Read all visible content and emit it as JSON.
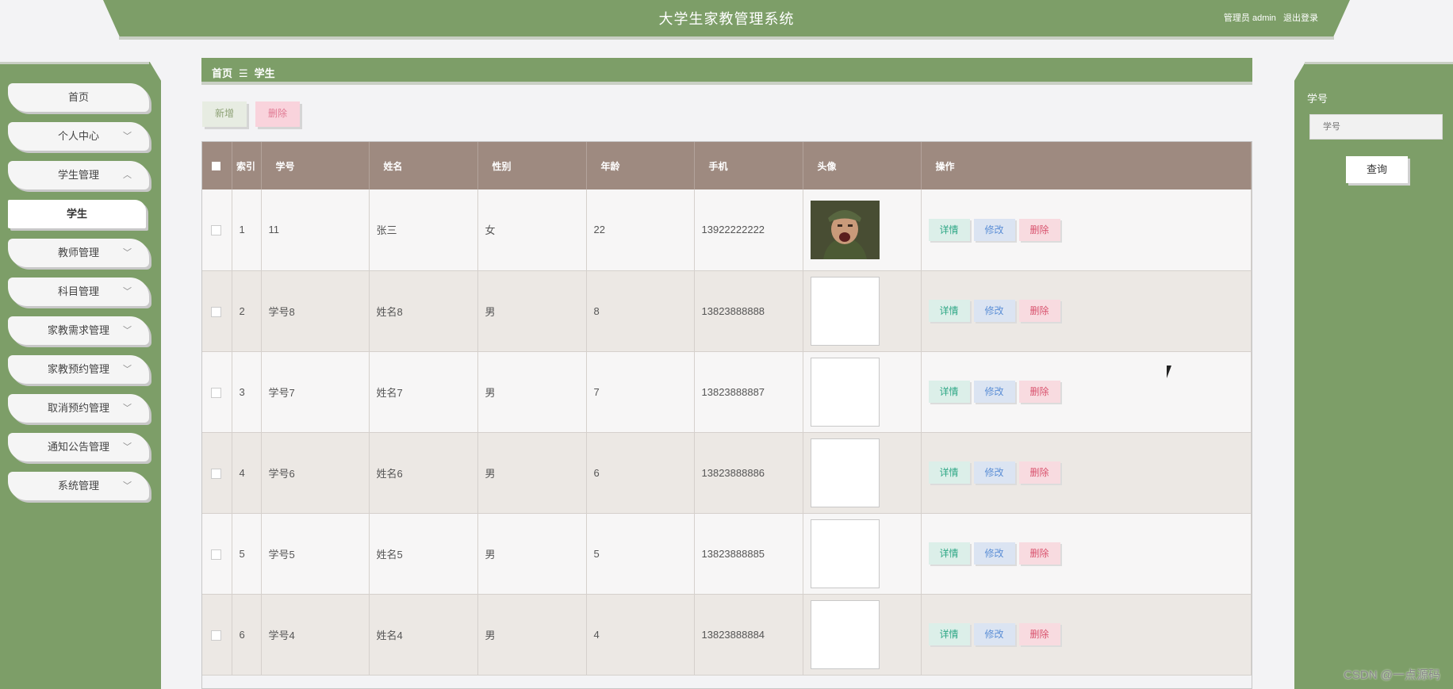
{
  "header": {
    "title": "大学生家教管理系统",
    "user": "管理员 admin",
    "logout": "退出登录"
  },
  "sidebar": {
    "items": [
      {
        "label": "首页",
        "chevron": ""
      },
      {
        "label": "个人中心",
        "chevron": "﹀"
      },
      {
        "label": "学生管理",
        "chevron": "︿"
      },
      {
        "label": "学生",
        "chevron": ""
      },
      {
        "label": "教师管理",
        "chevron": "﹀"
      },
      {
        "label": "科目管理",
        "chevron": "﹀"
      },
      {
        "label": "家教需求管理",
        "chevron": "﹀"
      },
      {
        "label": "家教预约管理",
        "chevron": "﹀"
      },
      {
        "label": "取消预约管理",
        "chevron": "﹀"
      },
      {
        "label": "通知公告管理",
        "chevron": "﹀"
      },
      {
        "label": "系统管理",
        "chevron": "﹀"
      }
    ]
  },
  "breadcrumb": {
    "home": "首页",
    "separator": "☰",
    "current": "学生"
  },
  "actions": {
    "add": "新增",
    "delete": "删除"
  },
  "search": {
    "label": "学号",
    "placeholder": "学号",
    "button": "查询"
  },
  "table": {
    "headers": {
      "index": "索引",
      "student_no": "学号",
      "name": "姓名",
      "gender": "性别",
      "age": "年龄",
      "phone": "手机",
      "avatar": "头像",
      "ops": "操作"
    },
    "row_actions": {
      "detail": "详情",
      "edit": "修改",
      "delete": "删除"
    },
    "rows": [
      {
        "index": "1",
        "student_no": "11",
        "name": "张三",
        "gender": "女",
        "age": "22",
        "phone": "13922222222",
        "avatar": "photo"
      },
      {
        "index": "2",
        "student_no": "学号8",
        "name": "姓名8",
        "gender": "男",
        "age": "8",
        "phone": "13823888888",
        "avatar": "broken"
      },
      {
        "index": "3",
        "student_no": "学号7",
        "name": "姓名7",
        "gender": "男",
        "age": "7",
        "phone": "13823888887",
        "avatar": "broken"
      },
      {
        "index": "4",
        "student_no": "学号6",
        "name": "姓名6",
        "gender": "男",
        "age": "6",
        "phone": "13823888886",
        "avatar": "broken"
      },
      {
        "index": "5",
        "student_no": "学号5",
        "name": "姓名5",
        "gender": "男",
        "age": "5",
        "phone": "13823888885",
        "avatar": "broken"
      },
      {
        "index": "6",
        "student_no": "学号4",
        "name": "姓名4",
        "gender": "男",
        "age": "4",
        "phone": "13823888884",
        "avatar": "broken"
      }
    ]
  },
  "watermark": "CSDN @一点源码",
  "colors": {
    "accent": "#7d9e68",
    "table_header": "#9e8a80"
  }
}
